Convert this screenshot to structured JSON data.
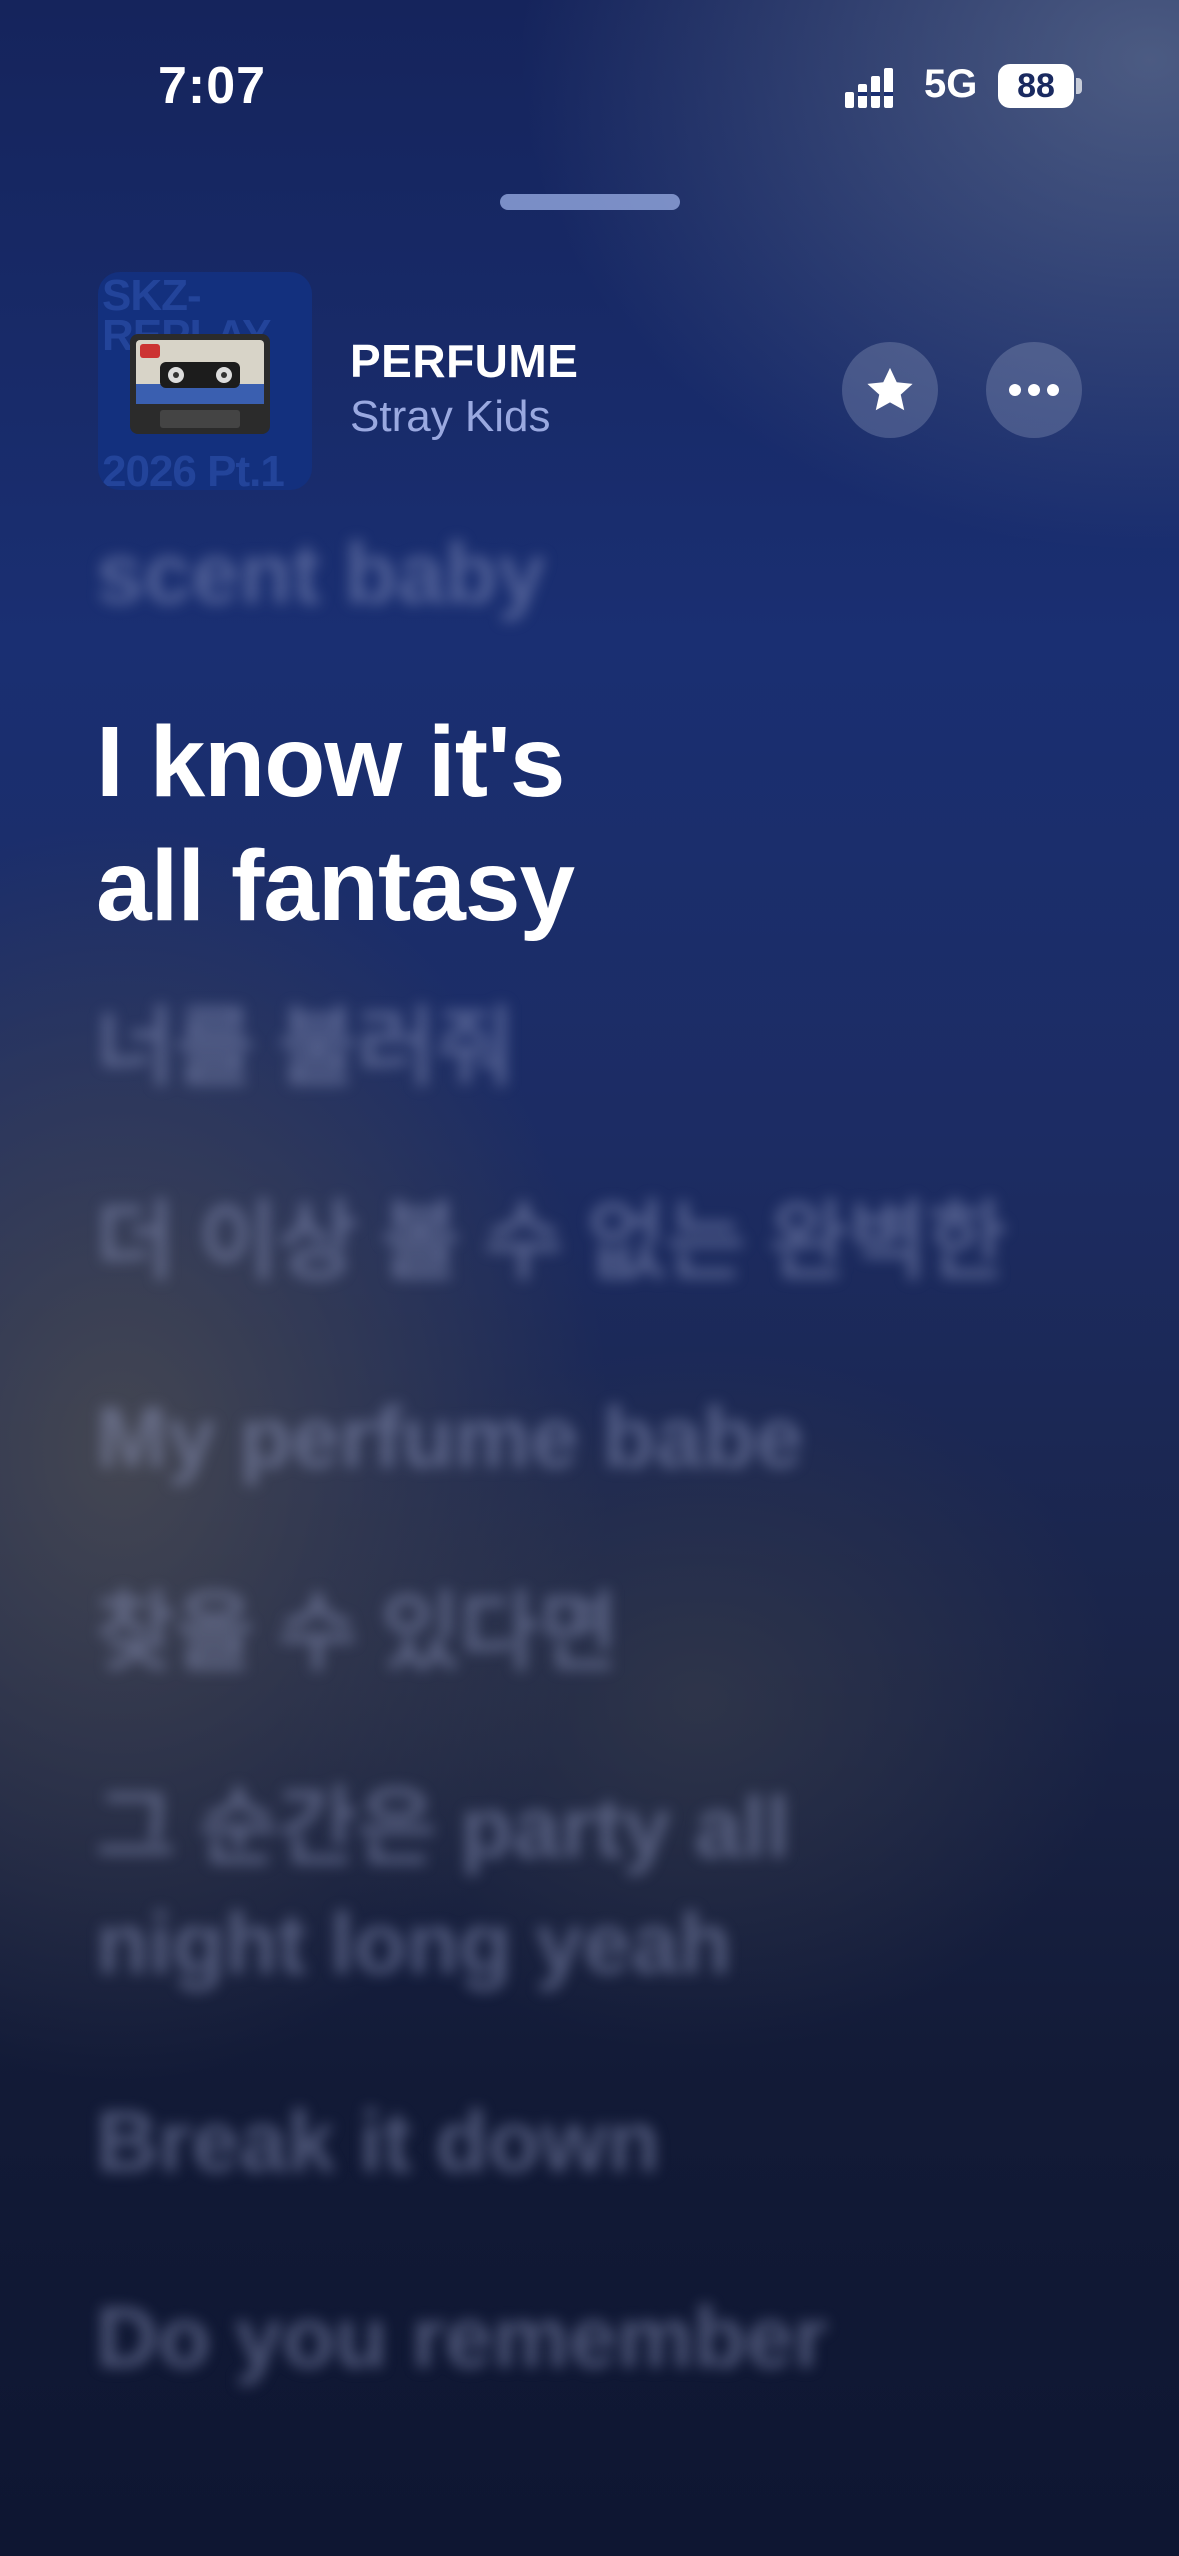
{
  "status_bar": {
    "time": "7:07",
    "network": "5G",
    "battery": "88"
  },
  "now_playing": {
    "artwork_text": [
      "SKZ-",
      "REPLAY",
      "2026 Pt.1"
    ],
    "title": "PERFUME",
    "artist": "Stray Kids"
  },
  "lyrics": [
    "scent baby",
    "I know it's\nall fantasy",
    "너를 불러줘",
    "더 이상 볼 수 없는 완벽한",
    "My perfume babe",
    "찾을 수 있다면",
    "그 순간은 party all\nnight long yeah",
    "Break it down",
    "Do you remember"
  ],
  "icons": {
    "favorite": "star-icon",
    "more": "ellipsis-icon",
    "signal": "cellular-signal-icon",
    "battery": "battery-icon"
  }
}
